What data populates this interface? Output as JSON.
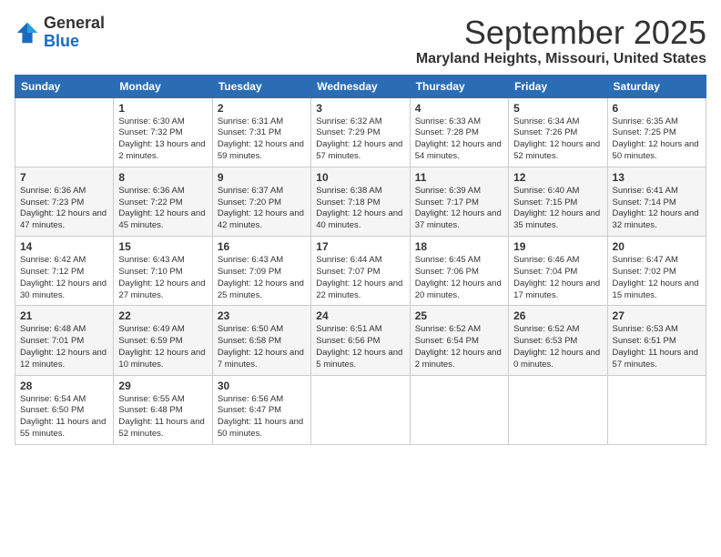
{
  "logo": {
    "general": "General",
    "blue": "Blue"
  },
  "title": "September 2025",
  "location": "Maryland Heights, Missouri, United States",
  "weekdays": [
    "Sunday",
    "Monday",
    "Tuesday",
    "Wednesday",
    "Thursday",
    "Friday",
    "Saturday"
  ],
  "weeks": [
    [
      {
        "day": "",
        "info": ""
      },
      {
        "day": "1",
        "info": "Sunrise: 6:30 AM\nSunset: 7:32 PM\nDaylight: 13 hours\nand 2 minutes."
      },
      {
        "day": "2",
        "info": "Sunrise: 6:31 AM\nSunset: 7:31 PM\nDaylight: 12 hours\nand 59 minutes."
      },
      {
        "day": "3",
        "info": "Sunrise: 6:32 AM\nSunset: 7:29 PM\nDaylight: 12 hours\nand 57 minutes."
      },
      {
        "day": "4",
        "info": "Sunrise: 6:33 AM\nSunset: 7:28 PM\nDaylight: 12 hours\nand 54 minutes."
      },
      {
        "day": "5",
        "info": "Sunrise: 6:34 AM\nSunset: 7:26 PM\nDaylight: 12 hours\nand 52 minutes."
      },
      {
        "day": "6",
        "info": "Sunrise: 6:35 AM\nSunset: 7:25 PM\nDaylight: 12 hours\nand 50 minutes."
      }
    ],
    [
      {
        "day": "7",
        "info": "Sunrise: 6:36 AM\nSunset: 7:23 PM\nDaylight: 12 hours\nand 47 minutes."
      },
      {
        "day": "8",
        "info": "Sunrise: 6:36 AM\nSunset: 7:22 PM\nDaylight: 12 hours\nand 45 minutes."
      },
      {
        "day": "9",
        "info": "Sunrise: 6:37 AM\nSunset: 7:20 PM\nDaylight: 12 hours\nand 42 minutes."
      },
      {
        "day": "10",
        "info": "Sunrise: 6:38 AM\nSunset: 7:18 PM\nDaylight: 12 hours\nand 40 minutes."
      },
      {
        "day": "11",
        "info": "Sunrise: 6:39 AM\nSunset: 7:17 PM\nDaylight: 12 hours\nand 37 minutes."
      },
      {
        "day": "12",
        "info": "Sunrise: 6:40 AM\nSunset: 7:15 PM\nDaylight: 12 hours\nand 35 minutes."
      },
      {
        "day": "13",
        "info": "Sunrise: 6:41 AM\nSunset: 7:14 PM\nDaylight: 12 hours\nand 32 minutes."
      }
    ],
    [
      {
        "day": "14",
        "info": "Sunrise: 6:42 AM\nSunset: 7:12 PM\nDaylight: 12 hours\nand 30 minutes."
      },
      {
        "day": "15",
        "info": "Sunrise: 6:43 AM\nSunset: 7:10 PM\nDaylight: 12 hours\nand 27 minutes."
      },
      {
        "day": "16",
        "info": "Sunrise: 6:43 AM\nSunset: 7:09 PM\nDaylight: 12 hours\nand 25 minutes."
      },
      {
        "day": "17",
        "info": "Sunrise: 6:44 AM\nSunset: 7:07 PM\nDaylight: 12 hours\nand 22 minutes."
      },
      {
        "day": "18",
        "info": "Sunrise: 6:45 AM\nSunset: 7:06 PM\nDaylight: 12 hours\nand 20 minutes."
      },
      {
        "day": "19",
        "info": "Sunrise: 6:46 AM\nSunset: 7:04 PM\nDaylight: 12 hours\nand 17 minutes."
      },
      {
        "day": "20",
        "info": "Sunrise: 6:47 AM\nSunset: 7:02 PM\nDaylight: 12 hours\nand 15 minutes."
      }
    ],
    [
      {
        "day": "21",
        "info": "Sunrise: 6:48 AM\nSunset: 7:01 PM\nDaylight: 12 hours\nand 12 minutes."
      },
      {
        "day": "22",
        "info": "Sunrise: 6:49 AM\nSunset: 6:59 PM\nDaylight: 12 hours\nand 10 minutes."
      },
      {
        "day": "23",
        "info": "Sunrise: 6:50 AM\nSunset: 6:58 PM\nDaylight: 12 hours\nand 7 minutes."
      },
      {
        "day": "24",
        "info": "Sunrise: 6:51 AM\nSunset: 6:56 PM\nDaylight: 12 hours\nand 5 minutes."
      },
      {
        "day": "25",
        "info": "Sunrise: 6:52 AM\nSunset: 6:54 PM\nDaylight: 12 hours\nand 2 minutes."
      },
      {
        "day": "26",
        "info": "Sunrise: 6:52 AM\nSunset: 6:53 PM\nDaylight: 12 hours\nand 0 minutes."
      },
      {
        "day": "27",
        "info": "Sunrise: 6:53 AM\nSunset: 6:51 PM\nDaylight: 11 hours\nand 57 minutes."
      }
    ],
    [
      {
        "day": "28",
        "info": "Sunrise: 6:54 AM\nSunset: 6:50 PM\nDaylight: 11 hours\nand 55 minutes."
      },
      {
        "day": "29",
        "info": "Sunrise: 6:55 AM\nSunset: 6:48 PM\nDaylight: 11 hours\nand 52 minutes."
      },
      {
        "day": "30",
        "info": "Sunrise: 6:56 AM\nSunset: 6:47 PM\nDaylight: 11 hours\nand 50 minutes."
      },
      {
        "day": "",
        "info": ""
      },
      {
        "day": "",
        "info": ""
      },
      {
        "day": "",
        "info": ""
      },
      {
        "day": "",
        "info": ""
      }
    ]
  ]
}
